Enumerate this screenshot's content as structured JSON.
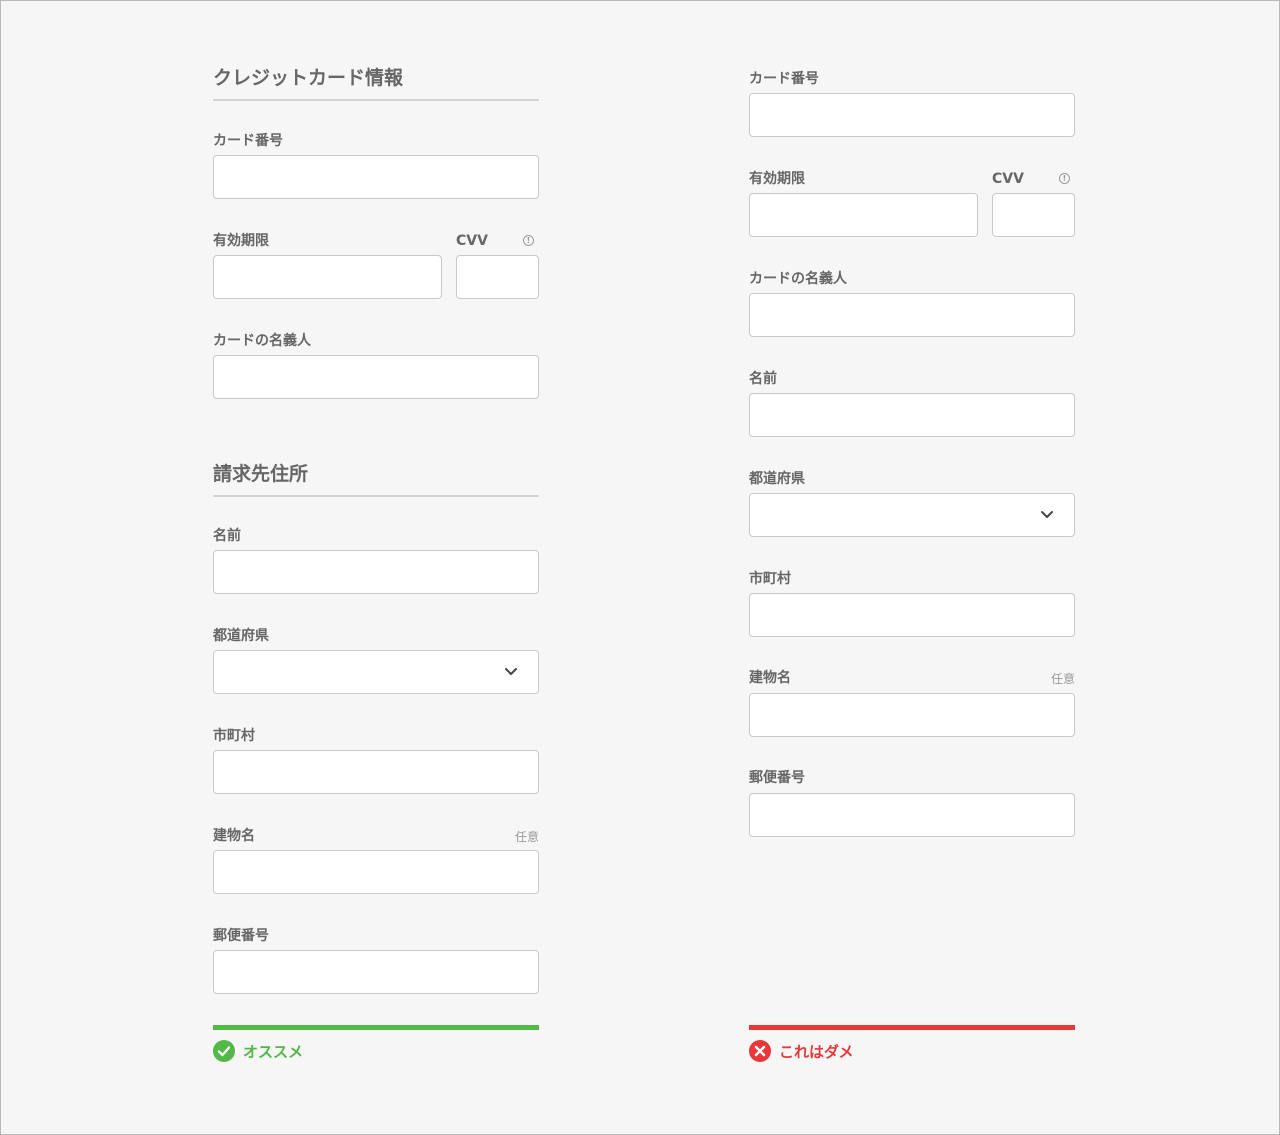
{
  "good": {
    "card_section_title": "クレジットカード情報",
    "card_number_label": "カード番号",
    "expiry_label": "有効期限",
    "cvv_label": "CVV",
    "cardholder_label": "カードの名義人",
    "billing_section_title": "請求先住所",
    "name_label": "名前",
    "prefecture_label": "都道府県",
    "city_label": "市町村",
    "building_label": "建物名",
    "optional_text": "任意",
    "postal_label": "郵便番号",
    "verdict_text": "オススメ"
  },
  "bad": {
    "card_number_label": "カード番号",
    "expiry_label": "有効期限",
    "cvv_label": "CVV",
    "cardholder_label": "カードの名義人",
    "name_label": "名前",
    "prefecture_label": "都道府県",
    "city_label": "市町村",
    "building_label": "建物名",
    "optional_text": "任意",
    "postal_label": "郵便番号",
    "verdict_text": "これはダメ"
  },
  "colors": {
    "good": "#52b846",
    "bad": "#e83838",
    "border": "#c9c9c9",
    "background": "#f6f6f6"
  },
  "icons": {
    "info": "info-icon",
    "chevron": "chevron-down-icon",
    "good": "check-circle-icon",
    "bad": "x-circle-icon"
  }
}
